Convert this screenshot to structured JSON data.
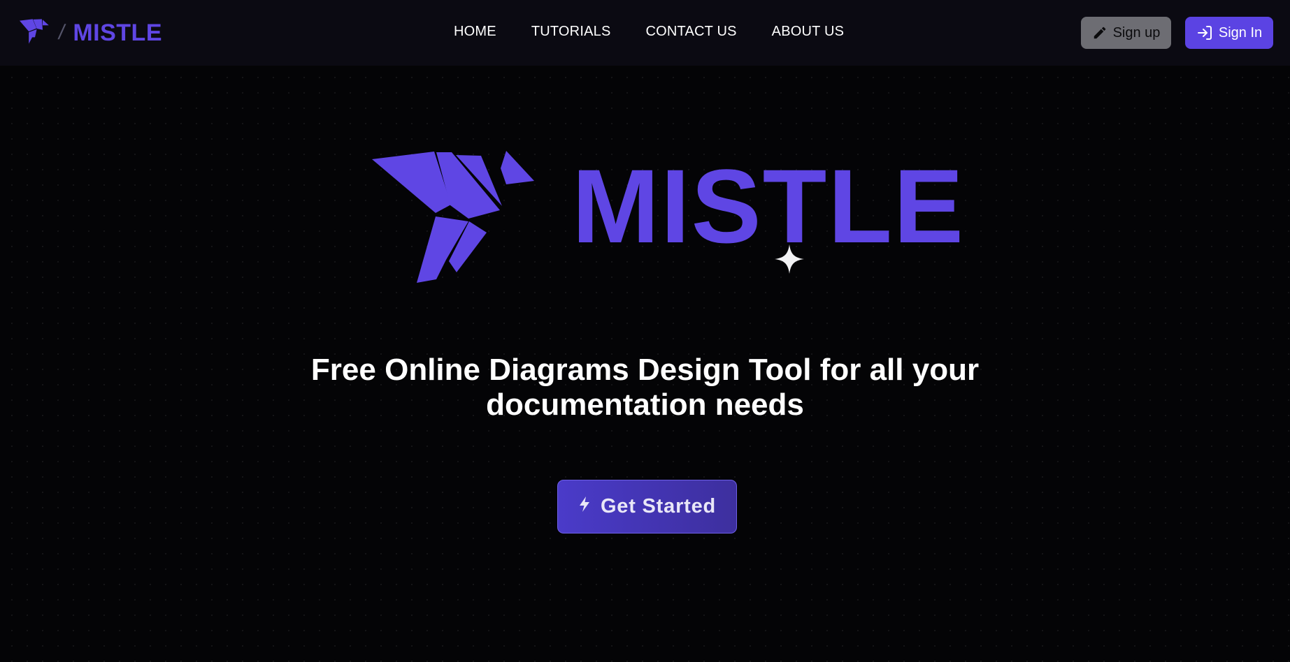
{
  "header": {
    "brand_name": "MISTLE",
    "brand_separator": "/",
    "brand_color": "#5f46e4",
    "nav": [
      {
        "label": "HOME"
      },
      {
        "label": "TUTORIALS"
      },
      {
        "label": "CONTACT US"
      },
      {
        "label": "ABOUT US"
      }
    ],
    "signup_label": "Sign up",
    "signup_icon": "pencil-icon",
    "signin_label": "Sign In",
    "signin_icon": "login-icon"
  },
  "hero": {
    "wordmark": "MISTLE",
    "logo_icon": "origami-bird-icon",
    "sparkle_icon": "sparkle-icon",
    "headline_line1": "Free Online Diagrams Design Tool for all your",
    "headline_line2": "documentation needs",
    "cta_label": "Get Started",
    "cta_icon": "lightning-icon"
  },
  "colors": {
    "accent": "#5f46e4",
    "background": "#040406",
    "topbar": "#0b0a12"
  }
}
